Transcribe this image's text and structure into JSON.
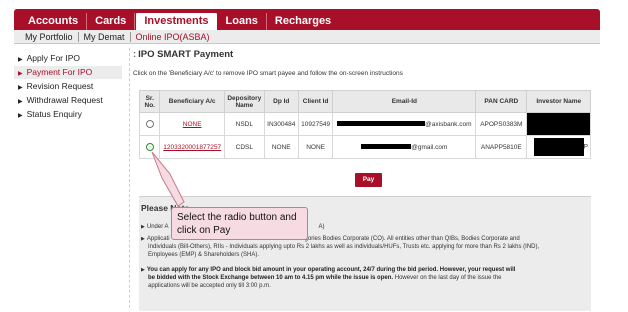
{
  "topnav": {
    "tabs": [
      {
        "label": "Accounts"
      },
      {
        "label": "Cards"
      },
      {
        "label": "Investments"
      },
      {
        "label": "Loans"
      },
      {
        "label": "Recharges"
      }
    ],
    "active": "Investments"
  },
  "subnav": {
    "items": [
      {
        "label": "My Portfolio"
      },
      {
        "label": "My Demat"
      },
      {
        "label": "Online IPO(ASBA)"
      }
    ],
    "active": "Online IPO(ASBA)"
  },
  "sidebar": {
    "items": [
      {
        "label": "Apply For IPO"
      },
      {
        "label": "Payment For IPO"
      },
      {
        "label": "Revision Request"
      },
      {
        "label": "Withdrawal Request"
      },
      {
        "label": "Status Enquiry"
      }
    ],
    "active": "Payment For IPO"
  },
  "main": {
    "title": "IPO SMART Payment",
    "instruction": "Click on the 'Beneficiary A/c' to remove IPO smart payee and follow the on-screen instructions",
    "columns": [
      "Sr. No.",
      "Beneficiary A/c",
      "Depository Name",
      "Dp Id",
      "Client Id",
      "Email-Id",
      "PAN CARD",
      "Investor Name"
    ],
    "rows": [
      {
        "selected": false,
        "beneficiary": "NONE",
        "depository": "NSDL",
        "dp_id": "IN300484",
        "client_id": "10927549",
        "email_suffix": "@axisbank.com",
        "pan": "APOPS0383M",
        "investor_tail": ""
      },
      {
        "selected": true,
        "beneficiary": "1203320001877257",
        "depository": "CDSL",
        "dp_id": "NONE",
        "client_id": "NONE",
        "email_suffix": "@gmail.com",
        "pan": "ANAPP5810E",
        "investor_tail": "P"
      }
    ],
    "pay_label": "Pay"
  },
  "note": {
    "title": "Please Note",
    "line1_prefix": "Under A",
    "line1_suffix": "A)",
    "line2a_prefix": "Applicati",
    "line2a_suffix": "tegories Bodies Corporate (CO). All entities other than QIBs, Bodies Corporate and",
    "line2b": "Individuals (Bill-Others), RIIs - Individuals applying upto Rs 2 lakhs as well as individuals/HUFs, Trusts etc. applying for more than Rs 2 lakhs (IND),",
    "line2c": "Employees (EMP) & Shareholders (SHA).",
    "line3a": "You can apply for any IPO and block bid amount in your operating account, 24/7 during the bid period. However, your request will",
    "line3b_bold": "be bidded with the Stock Exchange between 10 am to 4.15 pm while the issue is open.",
    "line3b_rest": " However on the last day of the issue the",
    "line3c": "applications will be accepted only till 3:00 p.m."
  },
  "callout": {
    "text": "Select the radio button and click on Pay"
  },
  "colors": {
    "brand": "#a8102a",
    "callout_bg": "#f6dce2"
  }
}
